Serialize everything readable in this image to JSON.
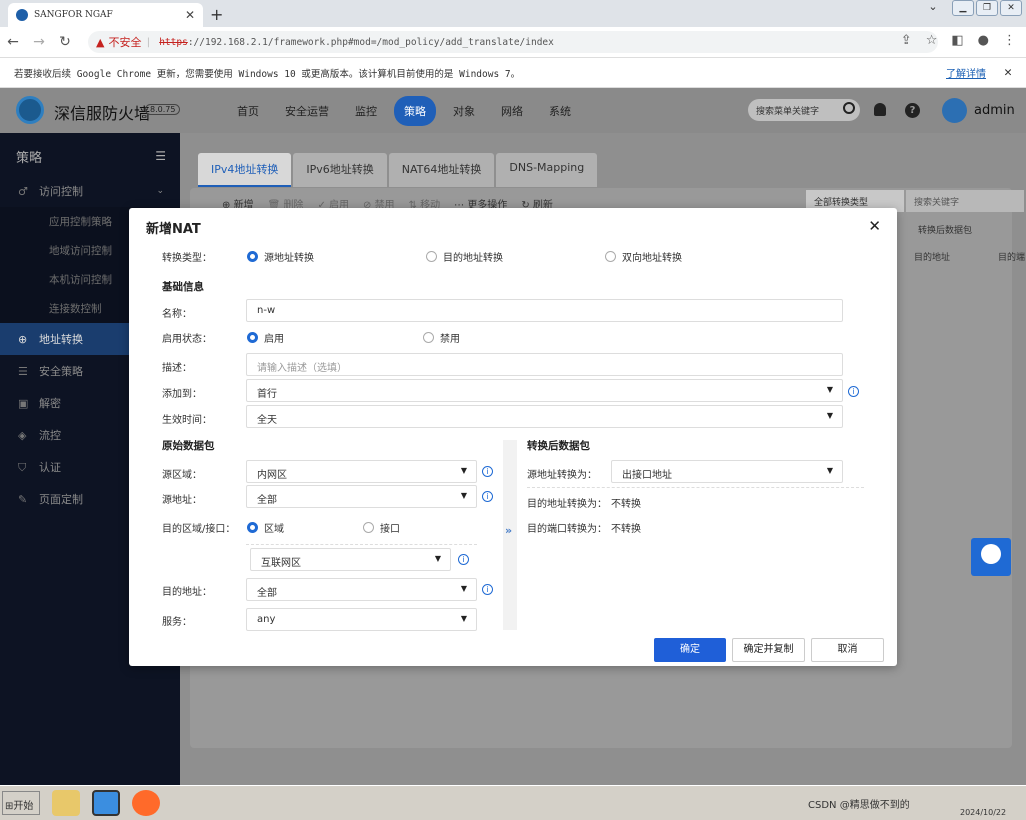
{
  "browser": {
    "tab_title": "SANGFOR NGAF",
    "new_tab": "+",
    "url_warning": "不安全",
    "url_scheme": "https",
    "url_rest": "://192.168.2.1/framework.php#mod=/mod_policy/add_translate/index"
  },
  "infobar": {
    "message": "若要接收后续 Google Chrome 更新，您需要使用 Windows 10 或更高版本。该计算机目前使用的是 Windows 7。",
    "link": "了解详情"
  },
  "app": {
    "brand": "深信服防火墙",
    "version": "8.0.75",
    "menu": [
      "首页",
      "安全运营",
      "监控",
      "策略",
      "对象",
      "网络",
      "系统"
    ],
    "search_placeholder": "搜索菜单关键字",
    "user": "admin"
  },
  "sidebar": {
    "title": "策略",
    "items": [
      {
        "label": "访问控制",
        "icon": "access-icon"
      },
      {
        "label": "应用控制策略"
      },
      {
        "label": "地域访问控制"
      },
      {
        "label": "本机访问控制"
      },
      {
        "label": "连接数控制"
      },
      {
        "label": "地址转换",
        "icon": "globe-icon"
      },
      {
        "label": "安全策略",
        "icon": "list-icon"
      },
      {
        "label": "解密",
        "icon": "lock-icon"
      },
      {
        "label": "流控",
        "icon": "flow-icon"
      },
      {
        "label": "认证",
        "icon": "shield-icon"
      },
      {
        "label": "页面定制",
        "icon": "edit-icon"
      }
    ]
  },
  "content": {
    "tabs": [
      "IPv4地址转换",
      "IPv6地址转换",
      "NAT64地址转换",
      "DNS-Mapping"
    ],
    "toolbar": [
      "新增",
      "删除",
      "启用",
      "禁用",
      "移动",
      "更多操作",
      "刷新"
    ],
    "filter": "全部转换类型",
    "search_placeholder": "搜索关键字",
    "col_group": "转换后数据包",
    "col_dst_addr": "目的地址",
    "col_dst_port": "目的端"
  },
  "modal": {
    "title": "新增NAT",
    "type_label": "转换类型：",
    "type_options": [
      "源地址转换",
      "目的地址转换",
      "双向地址转换"
    ],
    "basic_section": "基础信息",
    "name_label": "名称：",
    "name_value": "n-w",
    "status_label": "启用状态：",
    "status_options": [
      "启用",
      "禁用"
    ],
    "desc_label": "描述：",
    "desc_placeholder": "请输入描述（选填）",
    "add_to_label": "添加到：",
    "add_to_value": "首行",
    "time_label": "生效时间：",
    "time_value": "全天",
    "orig_section": "原始数据包",
    "src_zone_label": "源区域：",
    "src_zone_value": "内网区",
    "src_addr_label": "源地址：",
    "src_addr_value": "全部",
    "dst_zone_label": "目的区域/接口：",
    "dst_zone_options": [
      "区域",
      "接口"
    ],
    "dst_zone_value": "互联网区",
    "dst_addr_label": "目的地址：",
    "dst_addr_value": "全部",
    "service_label": "服务：",
    "service_value": "any",
    "trans_section": "转换后数据包",
    "src_trans_label": "源地址转换为：",
    "src_trans_value": "出接口地址",
    "dst_trans_label": "目的地址转换为：",
    "dst_trans_value": "不转换",
    "port_trans_label": "目的端口转换为：",
    "port_trans_value": "不转换",
    "btn_ok": "确定",
    "btn_ok_copy": "确定并复制",
    "btn_cancel": "取消"
  },
  "taskbar": {
    "start": "开始",
    "tray": "CSDN @精思做不到的",
    "clock": "2024/10/22"
  }
}
